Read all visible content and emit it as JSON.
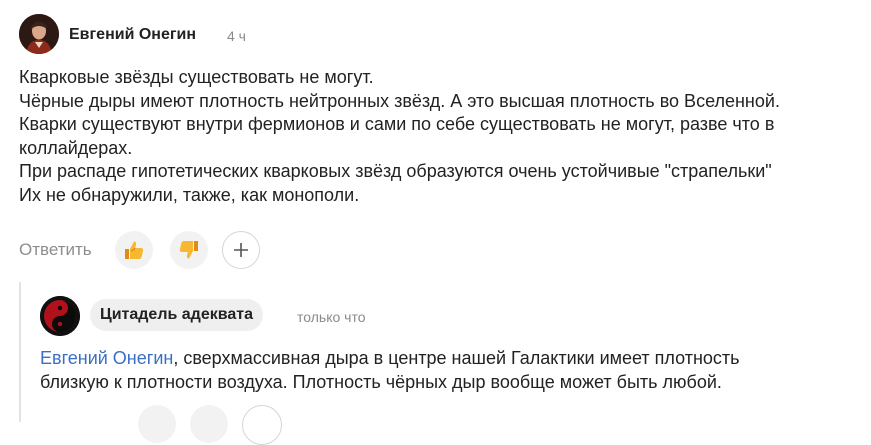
{
  "main_comment": {
    "author": "Евгений Онегин",
    "time": "4 ч",
    "lines": [
      "Кварковые звёзды существовать не могут.",
      "Чёрные дыры имеют плотность нейтронных звёзд. А это высшая плотность во Вселенной.",
      "Кварки существуют внутри фермионов и сами по себе существовать не могут, разве что в",
      "коллайдерах.",
      "При распаде гипотетических кварковых звёзд образуются очень устойчивые \"страпельки\"",
      "Их не обнаружили, также, как монополи."
    ],
    "actions": {
      "reply_label": "Ответить",
      "like_icon": "thumbs-up-icon",
      "dislike_icon": "thumbs-down-icon",
      "add_reaction_icon": "plus-icon"
    }
  },
  "reply_comment": {
    "author": "Цитадель адеквата",
    "time": "только что",
    "mention": "Евгений Онегин",
    "line1_rest": ", сверхмассивная дыра в центре нашей Галактики имеет плотность",
    "line2": "близкую к плотности воздуха. Плотность чёрных дыр вообще может быть любой."
  },
  "colors": {
    "mention": "#3a6fc4",
    "muted": "#8a8a8a",
    "reaction_bg": "#f2f2f2",
    "thumb": "#f5a623"
  }
}
